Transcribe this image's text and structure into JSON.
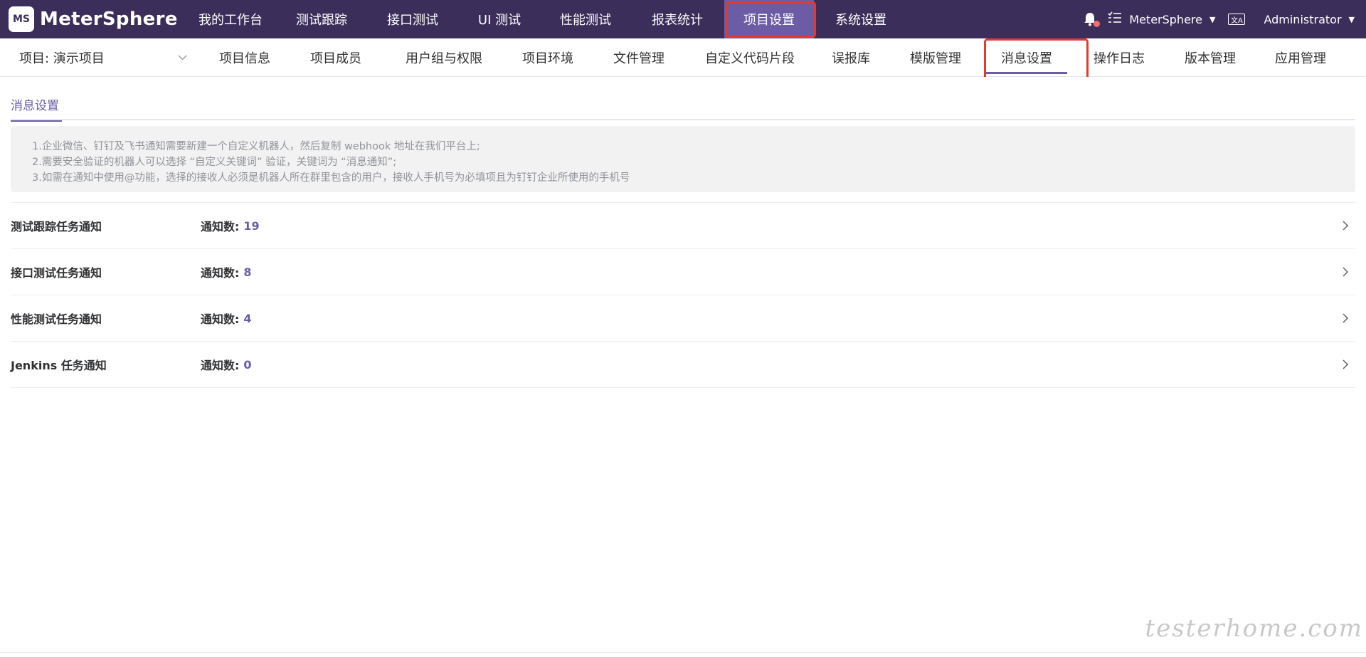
{
  "brand": {
    "logo_glyph": "MS",
    "name": "MeterSphere"
  },
  "top_nav": [
    {
      "label": "我的工作台",
      "active": false
    },
    {
      "label": "测试跟踪",
      "active": false
    },
    {
      "label": "接口测试",
      "active": false
    },
    {
      "label": "UI 测试",
      "active": false
    },
    {
      "label": "性能测试",
      "active": false
    },
    {
      "label": "报表统计",
      "active": false
    },
    {
      "label": "项目设置",
      "active": true
    },
    {
      "label": "系统设置",
      "active": false
    }
  ],
  "top_right": {
    "workspace": "MeterSphere",
    "lang_icon": "文A",
    "user": "Administrator"
  },
  "project_selector": {
    "value": "项目: 演示项目"
  },
  "sub_nav": [
    {
      "label": "项目信息",
      "active": false
    },
    {
      "label": "项目成员",
      "active": false
    },
    {
      "label": "用户组与权限",
      "active": false
    },
    {
      "label": "项目环境",
      "active": false
    },
    {
      "label": "文件管理",
      "active": false
    },
    {
      "label": "自定义代码片段",
      "active": false
    },
    {
      "label": "误报库",
      "active": false
    },
    {
      "label": "模版管理",
      "active": false
    },
    {
      "label": "消息设置",
      "active": true
    },
    {
      "label": "操作日志",
      "active": false
    },
    {
      "label": "版本管理",
      "active": false
    },
    {
      "label": "应用管理",
      "active": false
    }
  ],
  "content": {
    "tab": "消息设置",
    "notice": [
      "1.企业微信、钉钉及飞书通知需要新建一个自定义机器人，然后复制 webhook 地址在我们平台上;",
      "2.需要安全验证的机器人可以选择 “自定义关键词” 验证，关键词为 “消息通知”;",
      "3.如需在通知中使用@功能，选择的接收人必须是机器人所在群里包含的用户，接收人手机号为必填项且为钉钉企业所使用的手机号"
    ],
    "count_label": "通知数:",
    "rows": [
      {
        "title": "测试跟踪任务通知",
        "count": "19"
      },
      {
        "title": "接口测试任务通知",
        "count": "8"
      },
      {
        "title": "性能测试任务通知",
        "count": "4"
      },
      {
        "title": "Jenkins 任务通知",
        "count": "0"
      }
    ]
  },
  "watermark": "testerhome.com",
  "colors": {
    "topbar": "#3b2e5a",
    "accent": "#6b5ca5",
    "annotation": "#e23b2e"
  }
}
